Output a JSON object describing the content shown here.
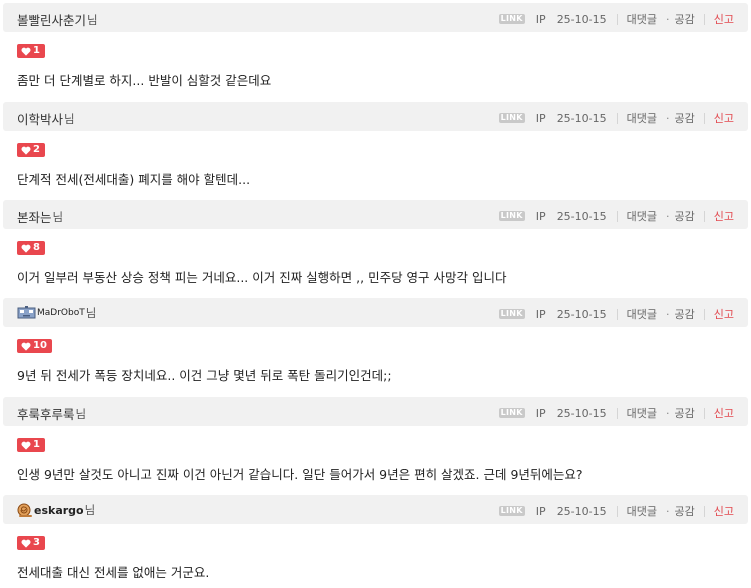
{
  "comments": [
    {
      "author": "볼빨린사춘기",
      "suffix": "님",
      "author_type": "text",
      "link_badge": "LINK",
      "ip_label": "IP",
      "date": "25-10-15",
      "reply_label": "대댓글",
      "like_label": "공감",
      "report_label": "신고",
      "likes": "1",
      "text": "좀만 더 단계별로 하지... 반발이 심할것 같은데요"
    },
    {
      "author": "이학박사",
      "suffix": "님",
      "author_type": "text",
      "link_badge": "LINK",
      "ip_label": "IP",
      "date": "25-10-15",
      "reply_label": "대댓글",
      "like_label": "공감",
      "report_label": "신고",
      "likes": "2",
      "text": "단계적 전세(전세대출) 폐지를 해야 할텐데..."
    },
    {
      "author": "본좌는",
      "suffix": "님",
      "author_type": "text",
      "link_badge": "LINK",
      "ip_label": "IP",
      "date": "25-10-15",
      "reply_label": "대댓글",
      "like_label": "공감",
      "report_label": "신고",
      "likes": "8",
      "text": "이거 일부러 부동산 상승 정책 피는 거네요... 이거 진짜 실행하면 ,, 민주당 영구 사망각 입니다"
    },
    {
      "author": "MaDrOboT",
      "suffix": "님",
      "author_type": "icon-robot",
      "link_badge": "LINK",
      "ip_label": "IP",
      "date": "25-10-15",
      "reply_label": "대댓글",
      "like_label": "공감",
      "report_label": "신고",
      "likes": "10",
      "text": "9년 뒤 전세가 폭등 장치네요.. 이건 그냥 몇년 뒤로 폭탄 돌리기인건데;;"
    },
    {
      "author": "후룩후루룩",
      "suffix": "님",
      "author_type": "text",
      "link_badge": "LINK",
      "ip_label": "IP",
      "date": "25-10-15",
      "reply_label": "대댓글",
      "like_label": "공감",
      "report_label": "신고",
      "likes": "1",
      "text": "인생 9년만 살것도 아니고 진짜 이건 아닌거 같습니다. 일단 들어가서 9년은 편히 살겠죠. 근데 9년뒤에는요?"
    },
    {
      "author": "eskargo",
      "suffix": "님",
      "author_type": "icon-snail",
      "link_badge": "LINK",
      "ip_label": "IP",
      "date": "25-10-15",
      "reply_label": "대댓글",
      "like_label": "공감",
      "report_label": "신고",
      "likes": "3",
      "text": "전세대출 대신 전세를 없애는 거군요."
    }
  ],
  "colors": {
    "header_bg": "#f1f1f1",
    "heart_badge": "#e9474e",
    "report": "#e2494f",
    "link_badge": "#c9c9c9"
  },
  "icons": {
    "like_badge": "heart-icon",
    "robot_nick": "robot-icon",
    "snail_nick": "snail-icon"
  }
}
